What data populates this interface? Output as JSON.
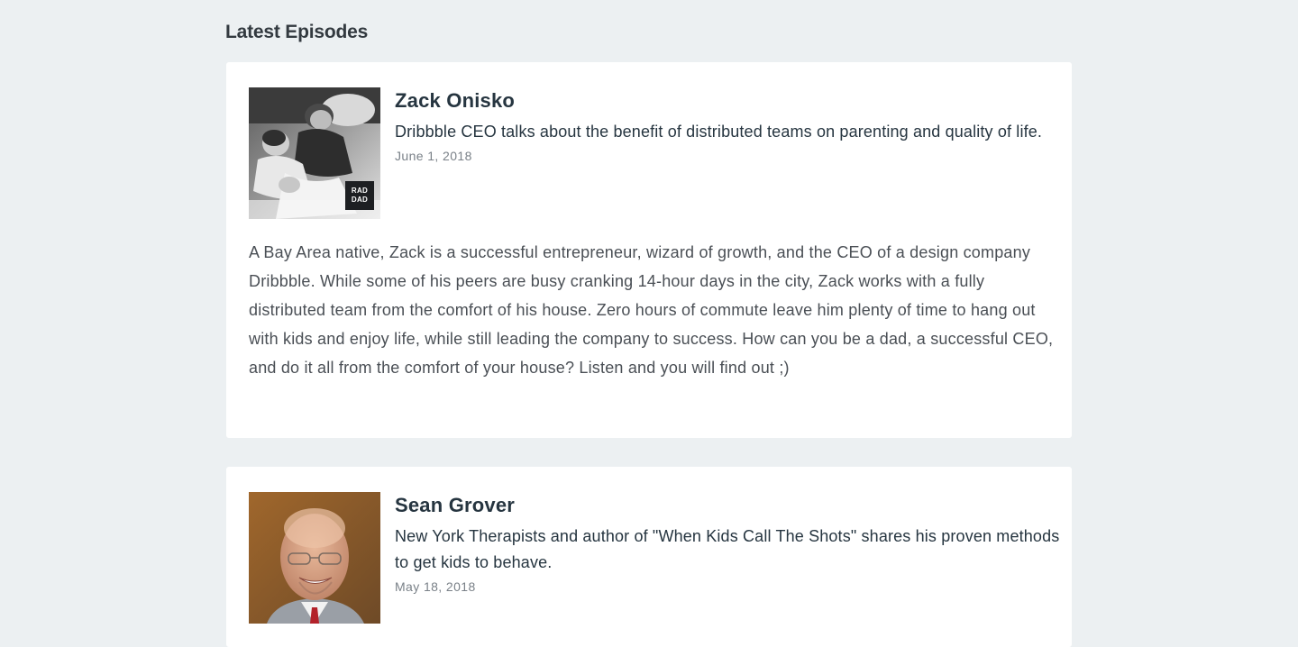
{
  "section": {
    "title": "Latest Episodes"
  },
  "episodes": [
    {
      "title": "Zack Onisko",
      "summary": "Dribbble CEO talks about the benefit of distributed teams on parenting and quality of life.",
      "date": "June 1, 2018",
      "badge": "RAD DAD",
      "badge_line1": "RAD",
      "badge_line2": "DAD",
      "description": "A Bay Area native, Zack is a successful entrepreneur, wizard of growth, and the CEO of a design company Dribbble. While some of his peers are busy cranking 14-hour days in the city, Zack works with a fully distributed team from the comfort of his house. Zero hours of commute leave him plenty of time to hang out with kids and enjoy life, while still leading the company to success. How can you be a dad, a successful CEO, and do it all from the comfort of your house? Listen and you will find out ;)",
      "thumb_icon": "father-with-kids-photo"
    },
    {
      "title": "Sean Grover",
      "summary": "New York Therapists and author of \"When Kids Call The Shots\" shares his proven methods to get kids to behave.",
      "date": "May 18, 2018",
      "thumb_icon": "portrait-photo"
    }
  ],
  "colors": {
    "background": "#ecf0f2",
    "card": "#ffffff",
    "title_text": "#263540",
    "body_text": "#4a4f55",
    "muted_text": "#7a8188"
  }
}
